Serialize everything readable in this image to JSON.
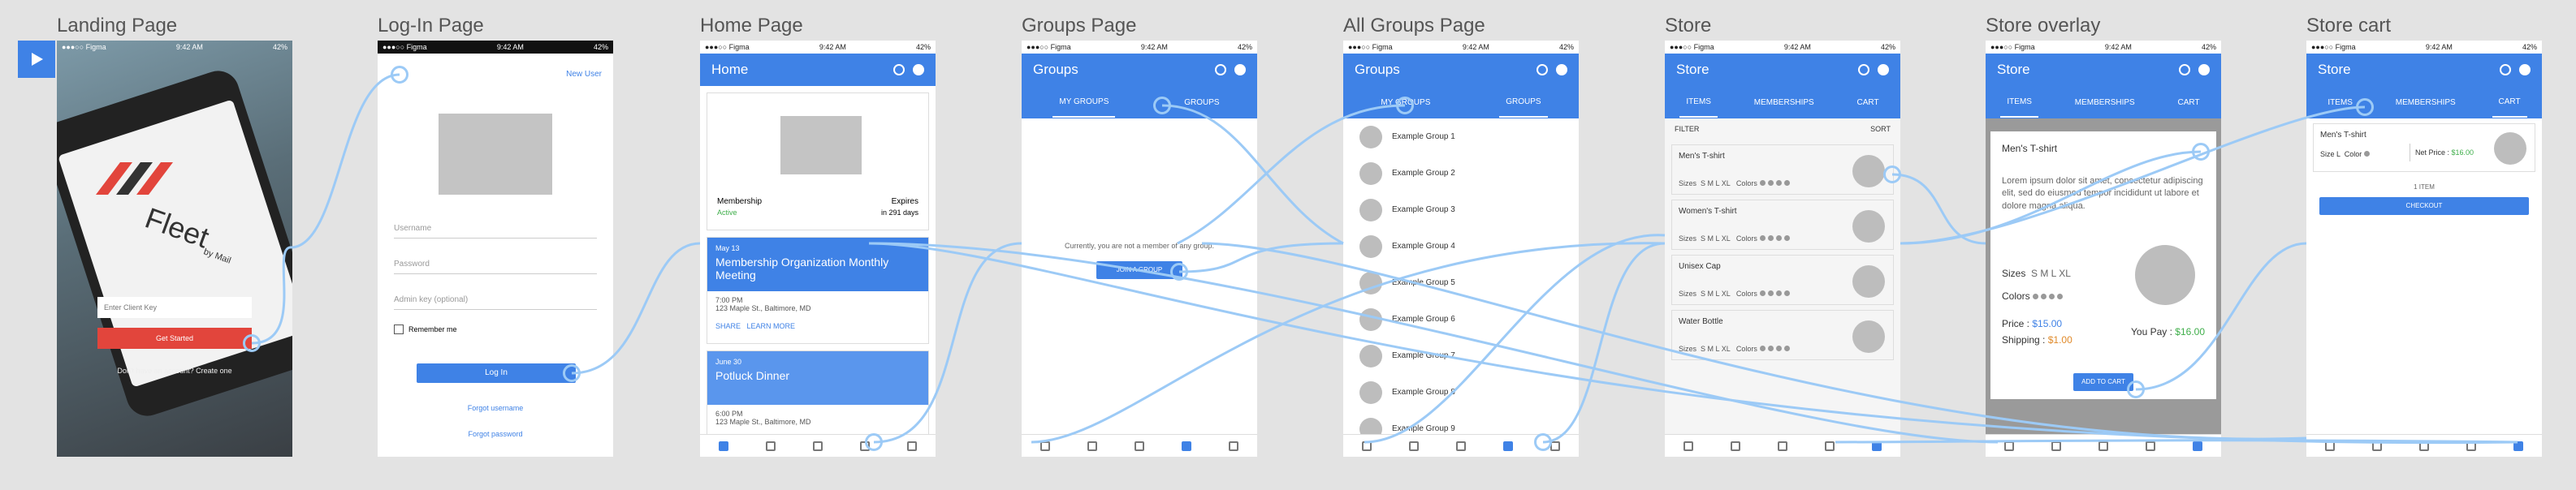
{
  "labels": {
    "landing": "Landing Page",
    "login": "Log-In Page",
    "home": "Home Page",
    "groups": "Groups Page",
    "allgroups": "All Groups Page",
    "store": "Store",
    "overlay": "Store overlay",
    "cart": "Store cart"
  },
  "status": {
    "carrier": "●●●○○ Figma",
    "time": "9:42 AM",
    "battery": "42%"
  },
  "landing": {
    "brand": "Fleet",
    "by": "by Mail",
    "client_key_placeholder": "Enter Client Key",
    "cta": "Get Started",
    "signup": "Don't have an account? Create one"
  },
  "login": {
    "new_user": "New User",
    "username": "Username",
    "password": "Password",
    "admin": "Admin key (optional)",
    "remember": "Remember me",
    "login_btn": "Log In",
    "forgot_user": "Forgot username",
    "forgot_pass": "Forgot password"
  },
  "home": {
    "title": "Home",
    "membership": "Membership",
    "active": "Active",
    "expires": "Expires",
    "expires_in": "in 291 days",
    "event1": {
      "date": "May 13",
      "title": "Membership Organization Monthly Meeting",
      "time": "7:00 PM",
      "addr": "123 Maple St., Baltimore, MD",
      "share": "SHARE",
      "learn": "LEARN MORE"
    },
    "event2": {
      "date": "June 30",
      "title": "Potluck Dinner",
      "time": "6:00 PM",
      "addr": "123 Maple St., Baltimore, MD"
    }
  },
  "groups": {
    "title": "Groups",
    "tab1": "MY GROUPS",
    "tab2": "GROUPS",
    "empty": "Currently, you are not a member of any group.",
    "join": "JOIN A GROUP"
  },
  "allgroups": {
    "title": "Groups",
    "tab1": "MY GROUPS",
    "tab2": "GROUPS",
    "items": [
      "Example Group 1",
      "Example Group 2",
      "Example Group 3",
      "Example Group 4",
      "Example Group 5",
      "Example Group 6",
      "Example Group 7",
      "Example Group 8",
      "Example Group 9"
    ]
  },
  "store": {
    "title": "Store",
    "tab1": "ITEMS",
    "tab2": "MEMBERSHIPS",
    "tab3": "CART",
    "filter": "FILTER",
    "sort": "SORT",
    "sizes": "Sizes",
    "size_vals": "S  M  L  XL",
    "colors": "Colors",
    "items": [
      "Men's T-shirt",
      "Women's T-shirt",
      "Unisex Cap",
      "Water Bottle"
    ]
  },
  "overlay": {
    "title": "Store",
    "item": "Men's T-shirt",
    "desc": "Lorem ipsum dolor sit amet, consectetur adipiscing elit, sed do eiusmod tempor incididunt ut labore et dolore magna aliqua.",
    "sizes": "Sizes",
    "size_vals": "S  M  L  XL",
    "colors": "Colors",
    "price_label": "Price :",
    "price": "$15.00",
    "ship_label": "Shipping :",
    "ship": "$1.00",
    "pay_label": "You Pay :",
    "pay": "$16.00",
    "add": "ADD TO CART"
  },
  "cart": {
    "title": "Store",
    "item": "Men's T-shirt",
    "size": "Size",
    "size_val": "L",
    "color": "Color",
    "net_label": "Net Price :",
    "net": "$16.00",
    "count": "1 ITEM",
    "checkout": "CHECKOUT"
  },
  "colors": {
    "accent": "#3f82e6",
    "wire": "#9ccaf6",
    "price": "#3f82e6",
    "shipping": "#e08a2a",
    "pay": "#3fae4a",
    "red": "#e2453c"
  }
}
